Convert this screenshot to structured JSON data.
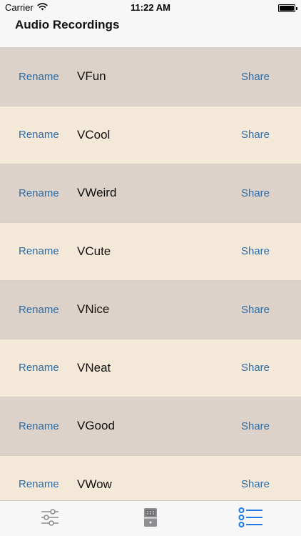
{
  "status_bar": {
    "carrier": "Carrier",
    "time": "11:22 AM",
    "wifi_icon": "wifi-icon",
    "battery_icon": "battery-icon",
    "battery_level": 1.0
  },
  "nav": {
    "title": "Audio Recordings"
  },
  "recordings": [
    {
      "rename_label": "Rename",
      "name": "VFun",
      "share_label": "Share"
    },
    {
      "rename_label": "Rename",
      "name": "VCool",
      "share_label": "Share"
    },
    {
      "rename_label": "Rename",
      "name": "VWeird",
      "share_label": "Share"
    },
    {
      "rename_label": "Rename",
      "name": "VCute",
      "share_label": "Share"
    },
    {
      "rename_label": "Rename",
      "name": "VNice",
      "share_label": "Share"
    },
    {
      "rename_label": "Rename",
      "name": "VNeat",
      "share_label": "Share"
    },
    {
      "rename_label": "Rename",
      "name": "VGood",
      "share_label": "Share"
    },
    {
      "rename_label": "Rename",
      "name": "VWow",
      "share_label": "Share"
    }
  ],
  "tab_bar": {
    "tabs": [
      {
        "icon": "sliders-icon",
        "selected": false
      },
      {
        "icon": "effects-pedal-icon",
        "selected": false
      },
      {
        "icon": "list-icon",
        "selected": true
      }
    ]
  },
  "colors": {
    "row_dark": "#ddd2c9",
    "row_light": "#f4e8d9",
    "link": "#2e6ca4",
    "tab_inactive": "#8e8e93",
    "tab_active": "#1e7ae6"
  }
}
